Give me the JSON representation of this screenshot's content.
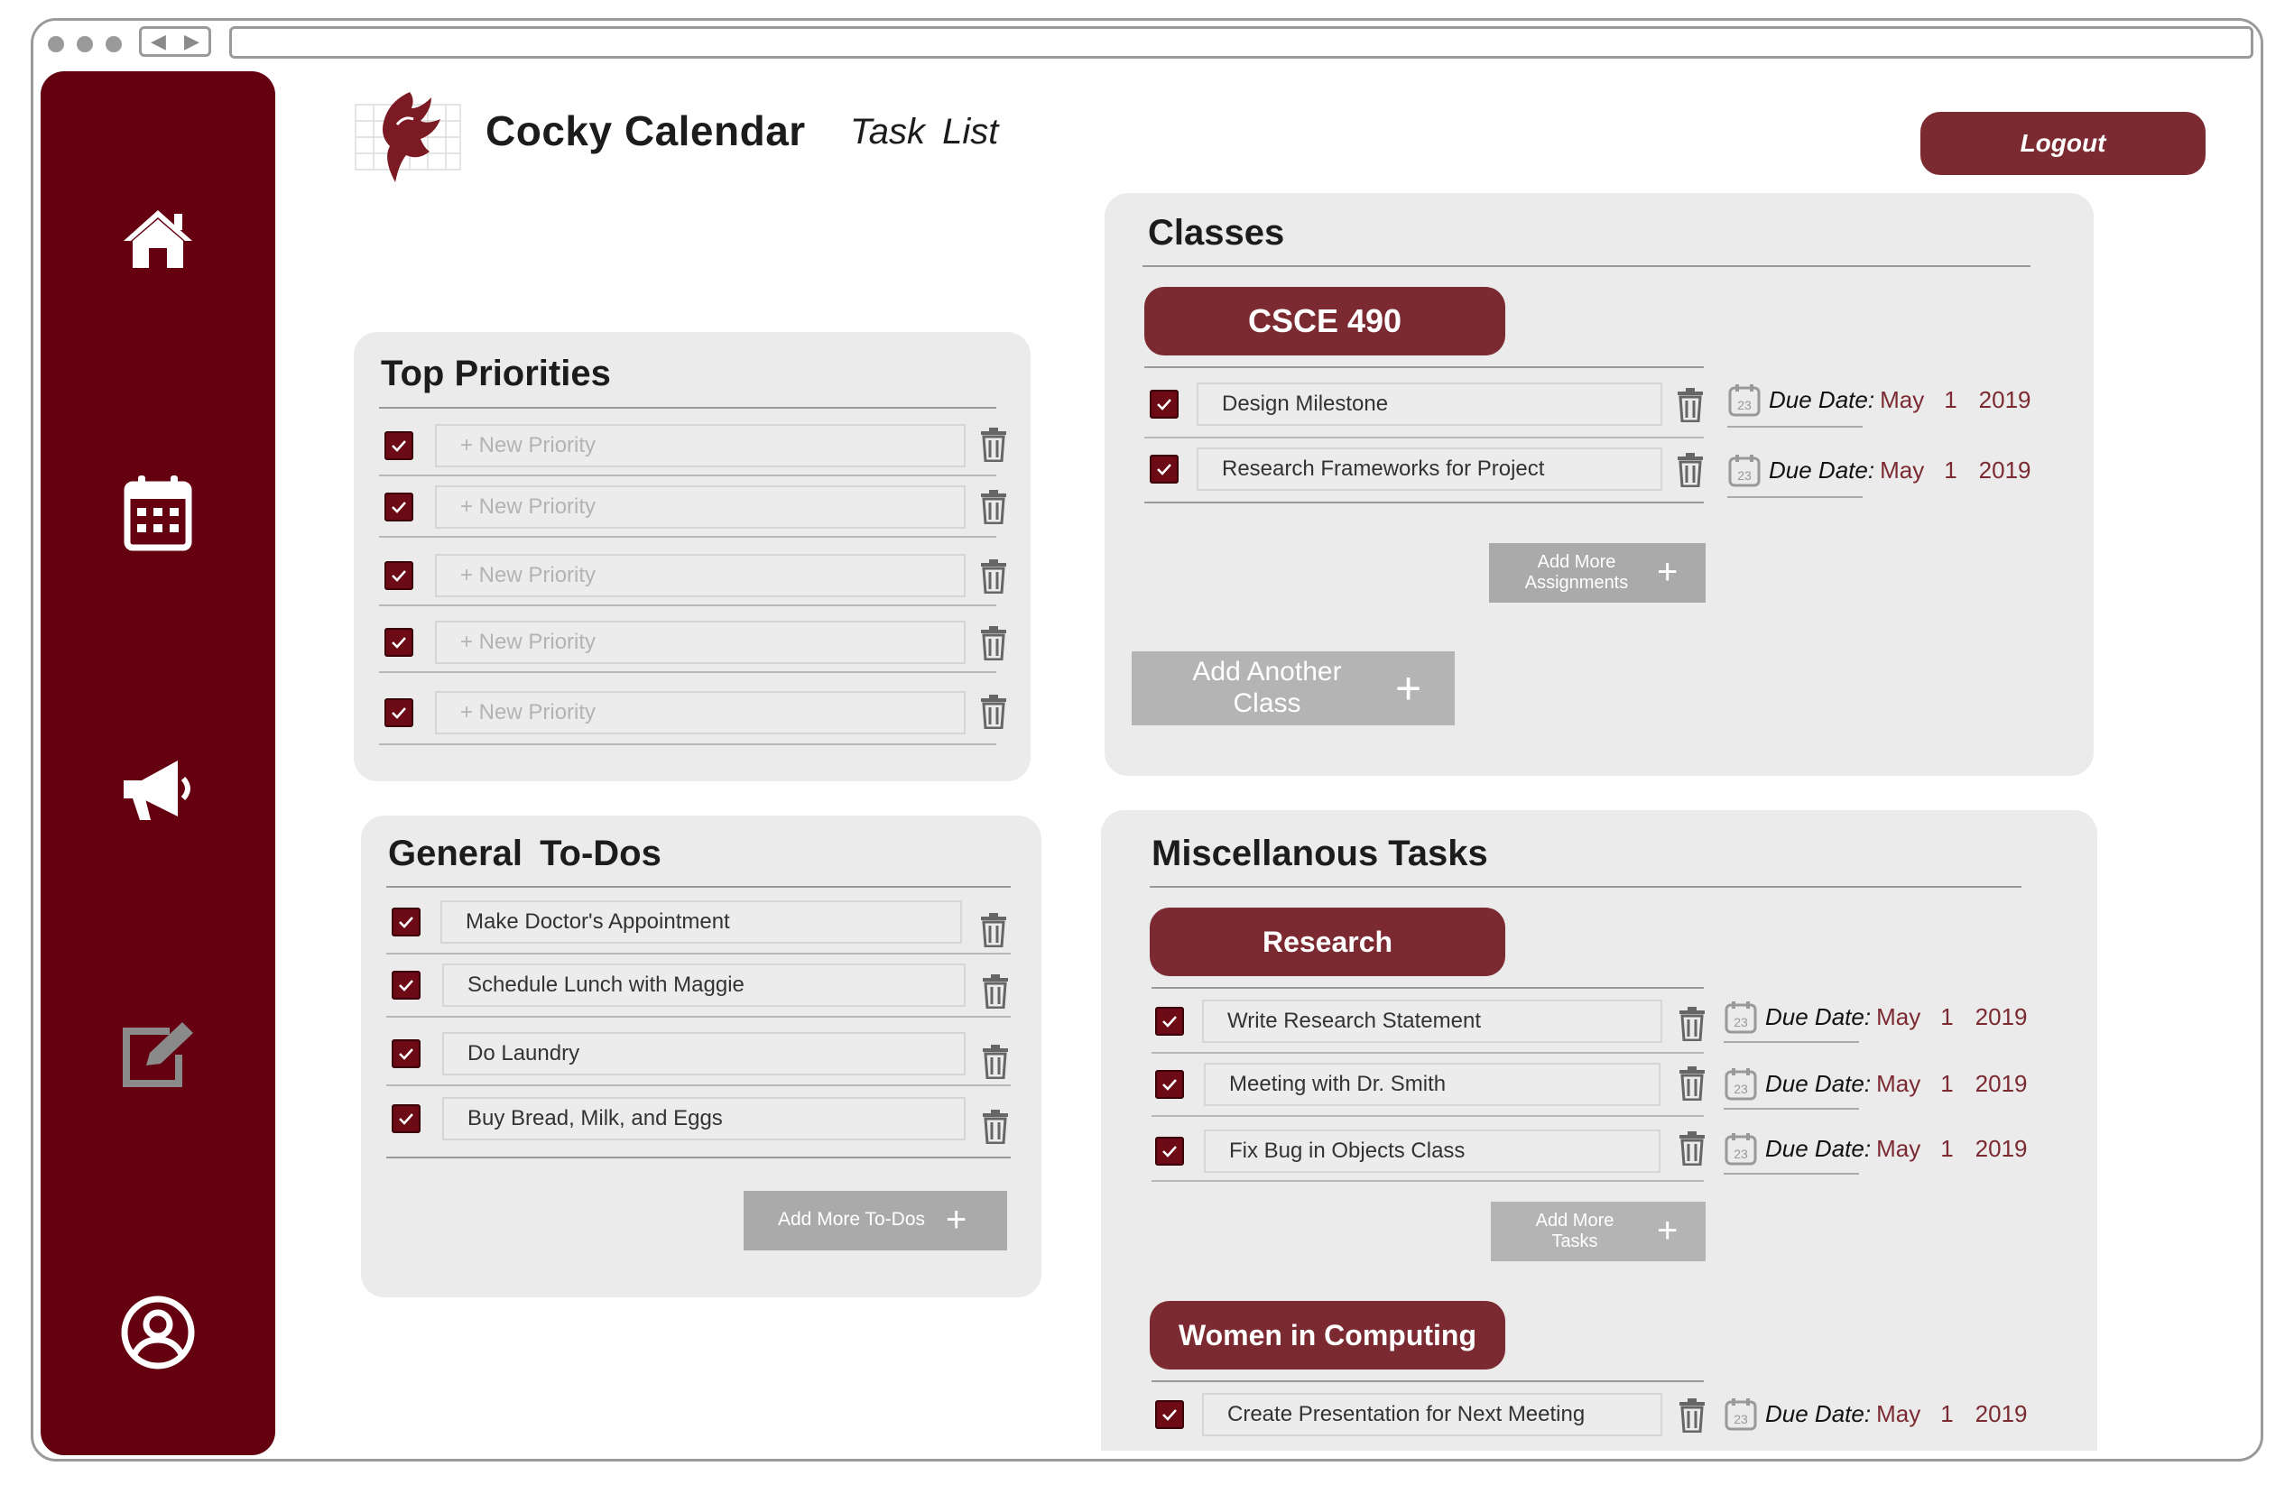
{
  "app": {
    "title": "Cocky Calendar",
    "page_title": "Task  List",
    "logout_label": "Logout",
    "brand_color": "#640010",
    "accent_color": "#7b2a32"
  },
  "sidebar": {
    "items": [
      {
        "icon": "home-icon"
      },
      {
        "icon": "calendar-icon"
      },
      {
        "icon": "megaphone-icon"
      },
      {
        "icon": "edit-icon"
      },
      {
        "icon": "profile-icon"
      }
    ]
  },
  "top_priorities": {
    "title": "Top Priorities",
    "items": [
      {
        "placeholder": "+ New Priority"
      },
      {
        "placeholder": "+ New Priority"
      },
      {
        "placeholder": "+ New Priority"
      },
      {
        "placeholder": "+ New Priority"
      },
      {
        "placeholder": "+ New Priority"
      }
    ]
  },
  "general_todos": {
    "title": "General  To-Dos",
    "items": [
      {
        "text": "Make Doctor's Appointment"
      },
      {
        "text": "Schedule Lunch with Maggie"
      },
      {
        "text": "Do Laundry"
      },
      {
        "text": "Buy Bread, Milk, and Eggs"
      }
    ],
    "add_label": "Add More To-Dos"
  },
  "classes": {
    "title": "Classes",
    "groups": [
      {
        "name": "CSCE 490",
        "tasks": [
          {
            "text": "Design Milestone",
            "due_label": "Due Date:",
            "month": "May",
            "day": "1",
            "year": "2019"
          },
          {
            "text": "Research Frameworks for Project",
            "due_label": "Due Date:",
            "month": "May",
            "day": "1",
            "year": "2019"
          }
        ],
        "add_label_1": "Add More",
        "add_label_2": "Assignments"
      }
    ],
    "add_class_label_1": "Add Another",
    "add_class_label_2": "Class"
  },
  "misc": {
    "title": "Miscellanous Tasks",
    "groups": [
      {
        "name": "Research",
        "tasks": [
          {
            "text": "Write Research Statement",
            "due_label": "Due Date:",
            "month": "May",
            "day": "1",
            "year": "2019"
          },
          {
            "text": "Meeting with Dr. Smith",
            "due_label": "Due Date:",
            "month": "May",
            "day": "1",
            "year": "2019"
          },
          {
            "text": "Fix Bug in Objects Class",
            "due_label": "Due Date:",
            "month": "May",
            "day": "1",
            "year": "2019"
          }
        ],
        "add_label_1": "Add More",
        "add_label_2": "Tasks"
      },
      {
        "name": "Women in Computing",
        "tasks": [
          {
            "text": "Create Presentation for Next Meeting",
            "due_label": "Due Date:",
            "month": "May",
            "day": "1",
            "year": "2019"
          }
        ]
      }
    ]
  },
  "calendar_icon_day": "23"
}
